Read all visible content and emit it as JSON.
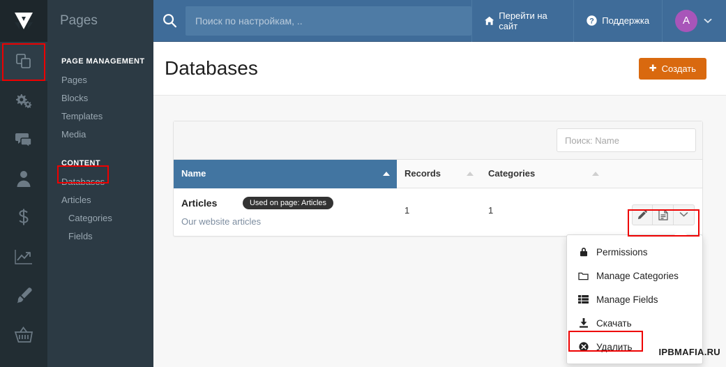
{
  "brand": {
    "logo_icon": "m-logo-icon",
    "accent_orange": "#d9690f",
    "header_blue": "#3f6c99",
    "sidebar_dark": "#2c3a44",
    "rail_dark": "#222d33",
    "sorted_header_blue": "#4275a1",
    "avatar_purple": "#a855b9",
    "annotation_red": "#ee0000"
  },
  "rail": {
    "items": [
      {
        "name": "pages-icon",
        "label": "Pages",
        "active": true
      },
      {
        "name": "settings-gears-icon",
        "label": "Settings",
        "active": false
      },
      {
        "name": "comments-icon",
        "label": "Comments",
        "active": false
      },
      {
        "name": "user-icon",
        "label": "Members",
        "active": false
      },
      {
        "name": "dollar-icon",
        "label": "Commerce",
        "active": false
      },
      {
        "name": "chart-growth-icon",
        "label": "Stats",
        "active": false
      },
      {
        "name": "paintbrush-icon",
        "label": "Customization",
        "active": false
      },
      {
        "name": "basket-icon",
        "label": "Store",
        "active": false
      }
    ]
  },
  "sidebar": {
    "title": "Pages",
    "groups": [
      {
        "title": "PAGE MANAGEMENT",
        "items": [
          {
            "label": "Pages",
            "indent": false,
            "highlighted": false
          },
          {
            "label": "Blocks",
            "indent": false,
            "highlighted": false
          },
          {
            "label": "Templates",
            "indent": false,
            "highlighted": false
          },
          {
            "label": "Media",
            "indent": false,
            "highlighted": false
          }
        ]
      },
      {
        "title": "CONTENT",
        "items": [
          {
            "label": "Databases",
            "indent": false,
            "highlighted": true
          },
          {
            "label": "Articles",
            "indent": false,
            "highlighted": false
          },
          {
            "label": "Categories",
            "indent": true,
            "highlighted": false
          },
          {
            "label": "Fields",
            "indent": true,
            "highlighted": false
          }
        ]
      }
    ]
  },
  "topbar": {
    "search_icon": "search-icon",
    "search_placeholder": "Поиск по настройкам, ..",
    "search_value": "",
    "go_to_site": {
      "label": "Перейти на сайт",
      "icon": "home-icon"
    },
    "support": {
      "label": "Поддержка",
      "icon": "question-circle-icon"
    },
    "avatar_initial": "A",
    "avatar_caret": "chevron-down-icon"
  },
  "page": {
    "title": "Databases",
    "create_button": {
      "label": "Создать",
      "icon": "plus-icon"
    }
  },
  "panel": {
    "search_placeholder": "Поиск: Name",
    "search_value": "",
    "columns": [
      {
        "label": "Name",
        "sorted": true,
        "sort_dir": "asc"
      },
      {
        "label": "Records",
        "sorted": false,
        "sort_dir": "asc"
      },
      {
        "label": "Categories",
        "sorted": false,
        "sort_dir": "asc"
      },
      {
        "label": "",
        "sorted": false,
        "sort_dir": ""
      }
    ],
    "rows": [
      {
        "name": "Articles",
        "badge": "Used on page: Articles",
        "description": "Our website articles",
        "records": "1",
        "categories": "1",
        "actions": [
          {
            "name": "edit-pencil-icon",
            "label": "Edit"
          },
          {
            "name": "document-icon",
            "label": "View"
          },
          {
            "name": "chevron-down-icon",
            "label": "More"
          }
        ]
      }
    ]
  },
  "dropdown": {
    "items": [
      {
        "label": "Permissions",
        "icon": "lock-icon",
        "highlighted": false
      },
      {
        "label": "Manage Categories",
        "icon": "folder-icon",
        "highlighted": false
      },
      {
        "label": "Manage Fields",
        "icon": "list-rows-icon",
        "highlighted": false
      },
      {
        "label": "Скачать",
        "icon": "download-icon",
        "highlighted": false
      },
      {
        "label": "Удалить",
        "icon": "delete-circle-icon",
        "highlighted": true
      }
    ]
  },
  "watermark": "IPBMAFIA.RU"
}
